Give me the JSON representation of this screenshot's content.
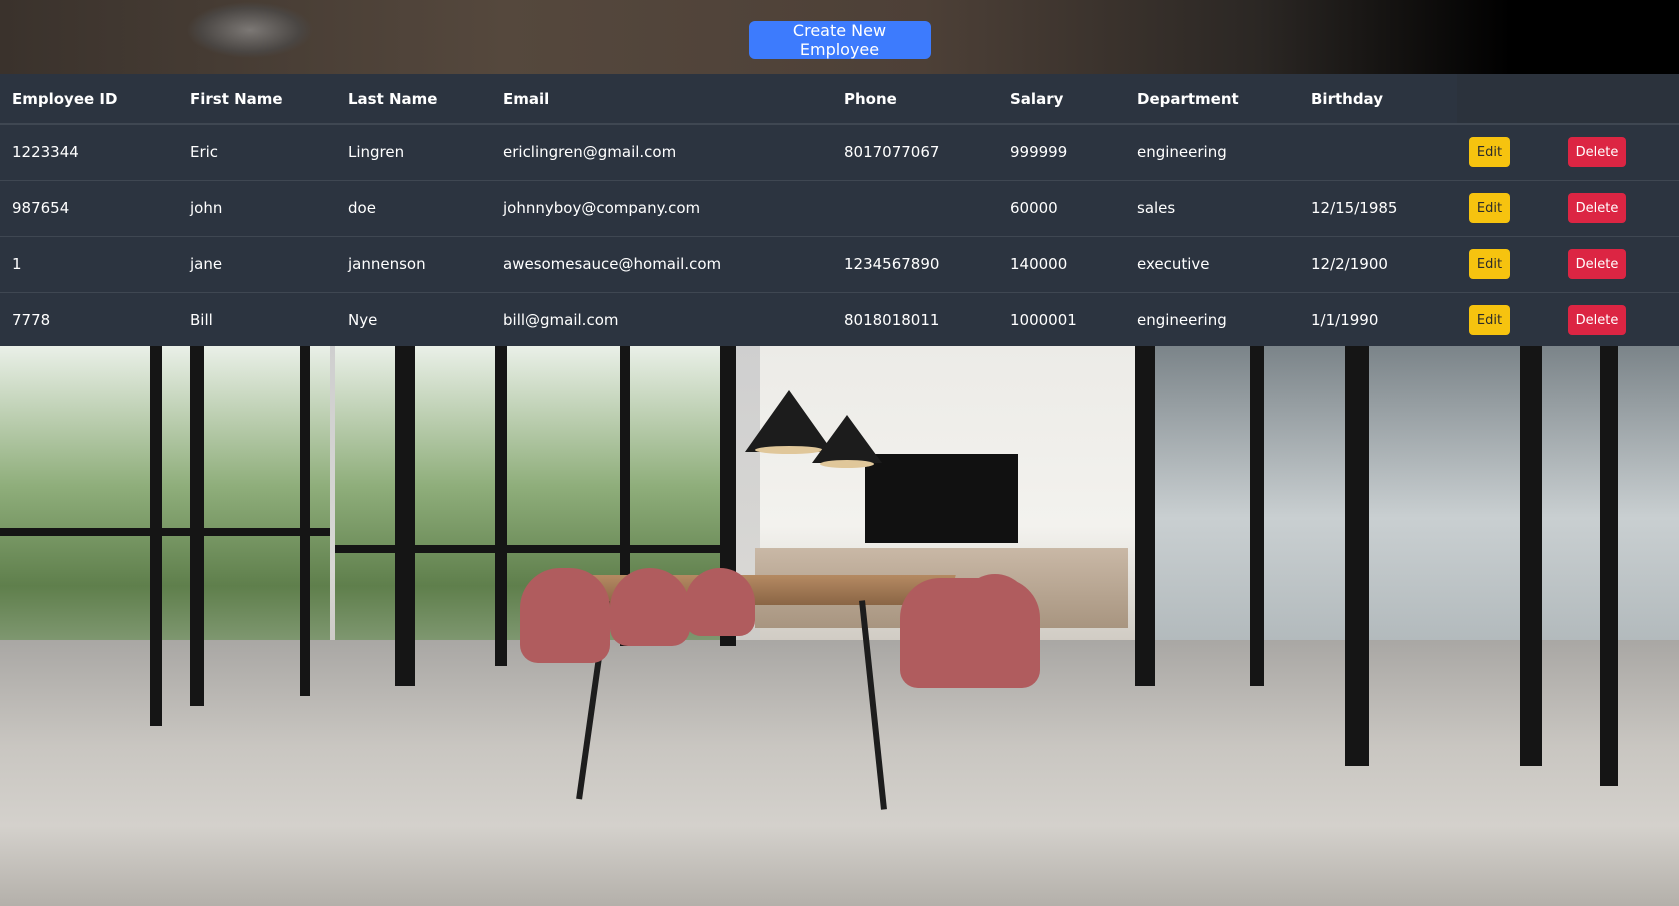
{
  "header": {
    "create_button_label": "Create New Employee"
  },
  "table": {
    "columns": [
      "Employee ID",
      "First Name",
      "Last Name",
      "Email",
      "Phone",
      "Salary",
      "Department",
      "Birthday"
    ],
    "rows": [
      {
        "id": "1223344",
        "first": "Eric",
        "last": "Lingren",
        "email": "ericlingren@gmail.com",
        "phone": "8017077067",
        "salary": "999999",
        "department": "engineering",
        "birthday": "",
        "edit": "Edit",
        "delete": "Delete"
      },
      {
        "id": "987654",
        "first": "john",
        "last": "doe",
        "email": "johnnyboy@company.com",
        "phone": "",
        "salary": "60000",
        "department": "sales",
        "birthday": "12/15/1985",
        "edit": "Edit",
        "delete": "Delete"
      },
      {
        "id": "1",
        "first": "jane",
        "last": "jannenson",
        "email": "awesomesauce@homail.com",
        "phone": "1234567890",
        "salary": "140000",
        "department": "executive",
        "birthday": "12/2/1900",
        "edit": "Edit",
        "delete": "Delete"
      },
      {
        "id": "7778",
        "first": "Bill",
        "last": "Nye",
        "email": "bill@gmail.com",
        "phone": "8018018011",
        "salary": "1000001",
        "department": "engineering",
        "birthday": "1/1/1990",
        "edit": "Edit",
        "delete": "Delete"
      }
    ]
  },
  "colors": {
    "primary": "#3d7bfd",
    "warning": "#f6c30f",
    "danger": "#dc2543",
    "table_bg": "#2c3440"
  }
}
